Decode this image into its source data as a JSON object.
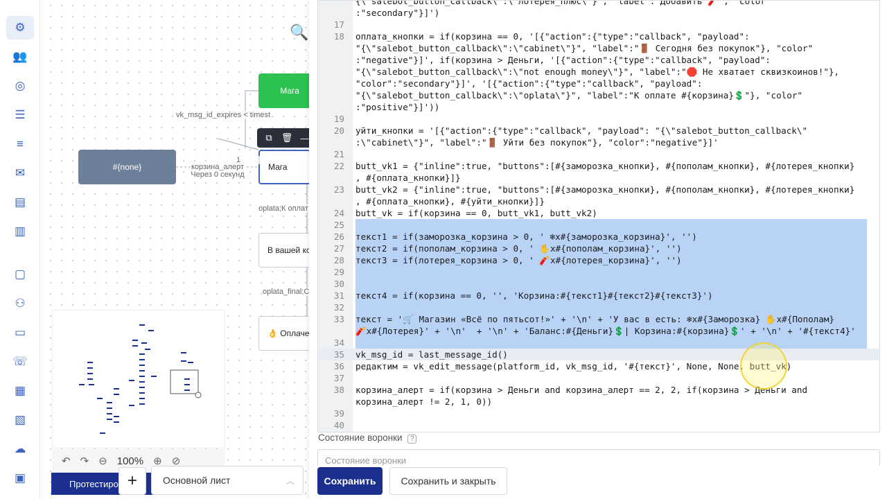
{
  "sidebar": {
    "items": [
      {
        "icon": "flow-icon"
      },
      {
        "icon": "users-icon"
      },
      {
        "icon": "target-icon"
      },
      {
        "icon": "list-icon"
      },
      {
        "icon": "bullet-list-icon"
      },
      {
        "icon": "mail-icon"
      },
      {
        "icon": "layers-icon"
      },
      {
        "icon": "chart-icon"
      },
      {
        "icon": "chat-icon"
      },
      {
        "icon": "network-icon"
      },
      {
        "icon": "card-icon"
      },
      {
        "icon": "phone-icon"
      },
      {
        "icon": "apps-icon"
      },
      {
        "icon": "doc-settings-icon"
      },
      {
        "icon": "cloud-icon"
      },
      {
        "icon": "wallet-icon"
      }
    ]
  },
  "canvas": {
    "node_none": "#{none}",
    "node_green": "Мага",
    "node_selected": "Мага",
    "node_cart": "В вашей кор",
    "node_paid": "👌 Оплачен",
    "edge_expires": "vk_msg_id_expires < timest",
    "edge_alert_num": "1",
    "edge_alert": "корзина_алерт",
    "edge_alert_time": "Через 0 секунд",
    "edge_oplata": "oplata;К оплат",
    "edge_final": "oplata_final;C"
  },
  "zoom": {
    "level": "100%"
  },
  "footer_left": {
    "test_label": "Протестиро",
    "plus": "+",
    "sheet": "Основной лист"
  },
  "editor": {
    "lines": [
      {
        "num": "",
        "text": "{\\\"salebot_button_callback\\\":\\\"лотерея_плюс\\\"}\", \"label\":\"Добавить 🧨\", \"color\""
      },
      {
        "num": "",
        "text": ":\"secondary\"}]')"
      },
      {
        "num": "17",
        "text": ""
      },
      {
        "num": "18",
        "text": "оплата_кнопки = if(корзина == 0, '[{\"action\":{\"type\":\"callback\", \"payload\":"
      },
      {
        "num": "",
        "text": "\"{\\\"salebot_button_callback\\\":\\\"cabinet\\\"}\", \"label\":\"🚪 Сегодня без покупок\"}, \"color\""
      },
      {
        "num": "",
        "text": ":\"negative\"}]', if(корзина > Деньги, '[{\"action\":{\"type\":\"callback\", \"payload\":"
      },
      {
        "num": "",
        "text": "\"{\\\"salebot_button_callback\\\":\\\"not enough money\\\"}\", \"label\":\"🛑 Не хватает сквизкоинов!\"},"
      },
      {
        "num": "",
        "text": "\"color\":\"secondary\"}]', '[{\"action\":{\"type\":\"callback\", \"payload\":"
      },
      {
        "num": "",
        "text": "\"{\\\"salebot_button_callback\\\":\\\"oplata\\\"}\", \"label\":\"К оплате #{корзина}💲\"}, \"color\""
      },
      {
        "num": "",
        "text": ":\"positive\"}]'))"
      },
      {
        "num": "19",
        "text": ""
      },
      {
        "num": "20",
        "text": "уйти_кнопки = '[{\"action\":{\"type\":\"callback\", \"payload\": \"{\\\"salebot_button_callback\\\""
      },
      {
        "num": "",
        "text": ":\\\"cabinet\\\"}\", \"label\":\"🚪 Уйти без покупок\"}, \"color\":\"negative\"}]'"
      },
      {
        "num": "21",
        "text": ""
      },
      {
        "num": "22",
        "text": "butt_vk1 = {\"inline\":true, \"buttons\":[#{заморозка_кнопки}, #{пополам_кнопки}, #{лотерея_кнопки}"
      },
      {
        "num": "",
        "text": ", #{оплата_кнопки}]}"
      },
      {
        "num": "23",
        "text": "butt_vk2 = {\"inline\":true, \"buttons\":[#{заморозка_кнопки}, #{пополам_кнопки}, #{лотерея_кнопки}"
      },
      {
        "num": "",
        "text": ", #{оплата_кнопки}, #{уйти_кнопки}]}"
      },
      {
        "num": "24",
        "text": "butt_vk = if(корзина == 0, butt_vk1, butt_vk2)"
      },
      {
        "num": "25",
        "text": ""
      },
      {
        "num": "26",
        "text": "текст1 = if(заморозка_корзина > 0, ' ❄x#{заморозка_корзина}', '')"
      },
      {
        "num": "27",
        "text": "текст2 = if(пополам_корзина > 0, ' ✋x#{пополам_корзина}', '')"
      },
      {
        "num": "28",
        "text": "текст3 = if(лотерея_корзина > 0, ' 🧨x#{лотерея_корзина}', '')"
      },
      {
        "num": "29",
        "text": ""
      },
      {
        "num": "30",
        "text": ""
      },
      {
        "num": "31",
        "text": "текст4 = if(корзина == 0, '', 'Корзина:#{текст1}#{текст2}#{текст3}')"
      },
      {
        "num": "32",
        "text": ""
      },
      {
        "num": "33",
        "text": "текст = '🛒 Магазин «Всё по пятьсот!»' + '\\n' + 'У вас в есть: ❄x#{Заморозка} ✋x#{Пополам}"
      },
      {
        "num": "",
        "text": "🧨x#{Лотерея}' + '\\n'  + '\\n' + 'Баланс:#{Деньги}💲| Корзина:#{корзина}💲' + '\\n' + '#{текст4}'"
      },
      {
        "num": "34",
        "text": ""
      },
      {
        "num": "35",
        "text": "vk_msg_id = last_message_id()"
      },
      {
        "num": "36",
        "text": "редактим = vk_edit_message(platform_id, vk_msg_id, '#{текст}', None, None, butt_vk)"
      },
      {
        "num": "37",
        "text": ""
      },
      {
        "num": "38",
        "text": "корзина_алерт = if(корзина > Деньги and корзина_алерт == 2, 2, if(корзина > Деньги and"
      },
      {
        "num": "",
        "text": "корзина_алерт != 2, 1, 0))"
      },
      {
        "num": "39",
        "text": ""
      },
      {
        "num": "40",
        "text": ""
      }
    ]
  },
  "state": {
    "label": "Состояние воронки",
    "help": "?",
    "placeholder": "Состояние воронки"
  },
  "buttons": {
    "save": "Сохранить",
    "save_close": "Сохранить и закрыть"
  }
}
